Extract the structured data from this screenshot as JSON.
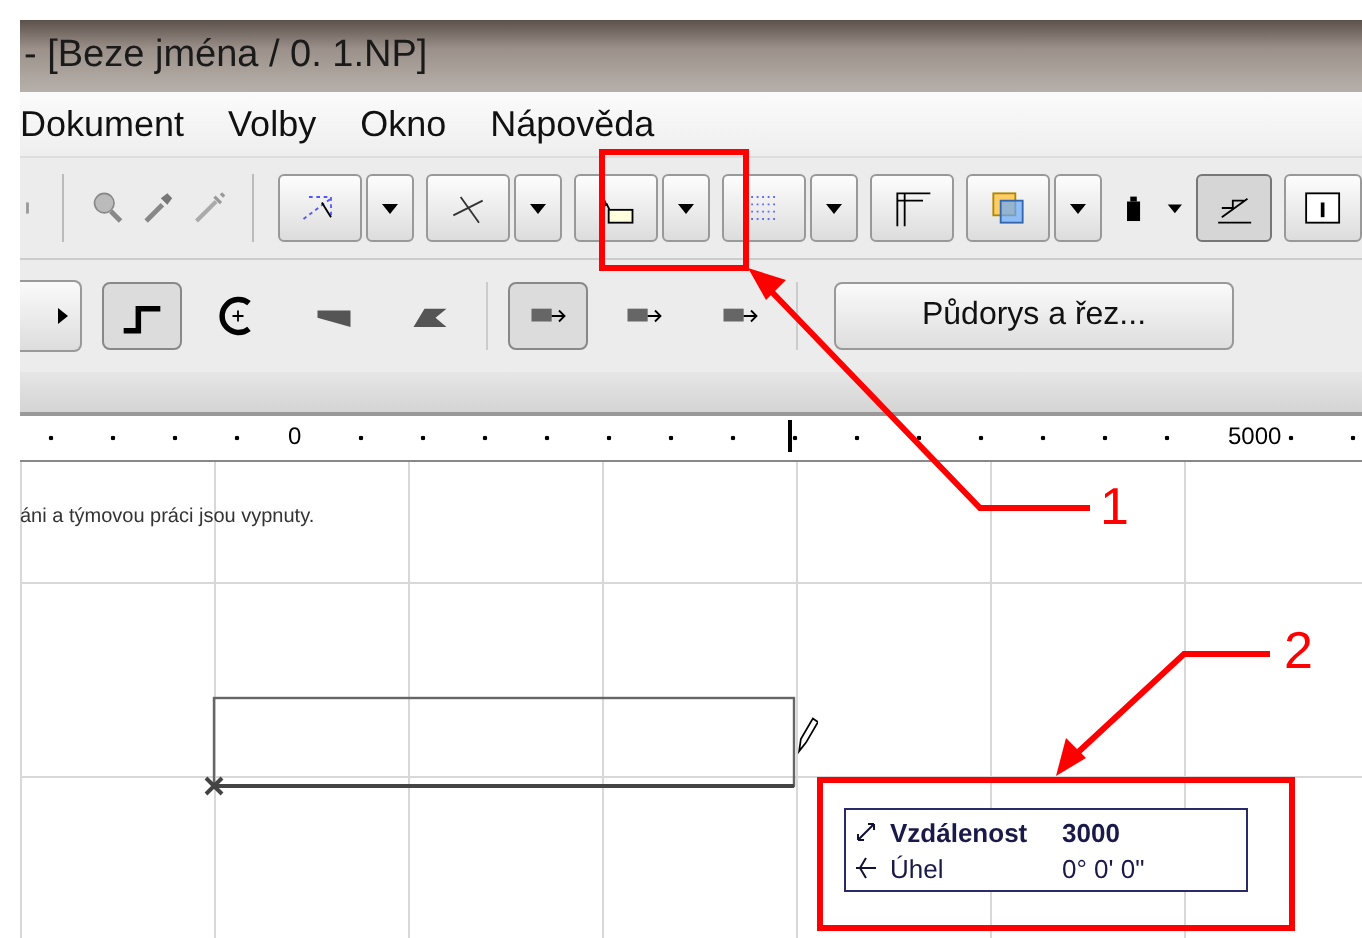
{
  "window": {
    "title": "- [Beze jména / 0. 1.NP]"
  },
  "menu": [
    "Dokument",
    "Volby",
    "Okno",
    "Nápověda"
  ],
  "geometry_methods": [
    {
      "selected": true
    },
    {
      "selected": false
    },
    {
      "selected": false
    },
    {
      "selected": false
    }
  ],
  "extrusion_methods": [
    {
      "selected": true
    },
    {
      "selected": false
    },
    {
      "selected": false
    }
  ],
  "view_button": "Půdorys a řez...",
  "ruler": {
    "labels": [
      "0",
      "5000"
    ]
  },
  "status_message": "áni a týmovou práci jsou vypnuty.",
  "tracker": [
    {
      "kind": "distance",
      "label": "Vzdálenost",
      "value": "3000"
    },
    {
      "kind": "angle",
      "label": "Úhel",
      "value": "0° 0' 0\""
    }
  ],
  "callouts": [
    "1",
    "2"
  ]
}
